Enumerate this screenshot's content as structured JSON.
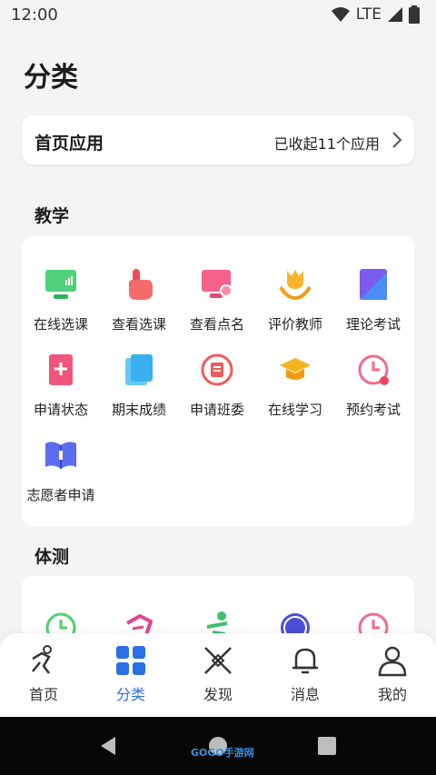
{
  "status_bar": {
    "time": "12:00",
    "network": "LTE",
    "icons": [
      "wifi-icon",
      "signal-icon",
      "battery-icon"
    ]
  },
  "page": {
    "title": "分类"
  },
  "home_apps": {
    "title": "首页应用",
    "status": "已收起11个应用"
  },
  "sections": [
    {
      "title": "教学",
      "items": [
        {
          "label": "在线选课",
          "icon": "monitor-icon"
        },
        {
          "label": "查看选课",
          "icon": "hand-pointer-icon"
        },
        {
          "label": "查看点名",
          "icon": "monitor-user-icon"
        },
        {
          "label": "评价教师",
          "icon": "tulip-hand-icon"
        },
        {
          "label": "理论考试",
          "icon": "exam-card-icon"
        },
        {
          "label": "申请状态",
          "icon": "document-plus-icon"
        },
        {
          "label": "期末成绩",
          "icon": "stacked-papers-icon"
        },
        {
          "label": "申请班委",
          "icon": "badge-list-icon"
        },
        {
          "label": "在线学习",
          "icon": "graduation-cap-icon"
        },
        {
          "label": "预约考试",
          "icon": "clock-icon"
        },
        {
          "label": "志愿者申请",
          "icon": "open-book-icon"
        }
      ]
    },
    {
      "title": "体测",
      "items": [
        {
          "icon": "green-clock-icon"
        },
        {
          "icon": "runner-icon"
        },
        {
          "icon": "figure-icon"
        },
        {
          "icon": "exempt-badge-icon"
        },
        {
          "icon": "red-clock-icon"
        }
      ]
    }
  ],
  "bottom_nav": [
    {
      "label": "首页",
      "icon": "runner-home-icon",
      "active": false
    },
    {
      "label": "分类",
      "icon": "grid-icon",
      "active": true
    },
    {
      "label": "发现",
      "icon": "compass-icon",
      "active": false
    },
    {
      "label": "消息",
      "icon": "bell-icon",
      "active": false
    },
    {
      "label": "我的",
      "icon": "user-icon",
      "active": false
    }
  ],
  "colors": {
    "accent": "#2b6fe6",
    "background": "#f4f4f6",
    "card": "#ffffff"
  },
  "watermark": {
    "text": "GOGO手游网"
  }
}
